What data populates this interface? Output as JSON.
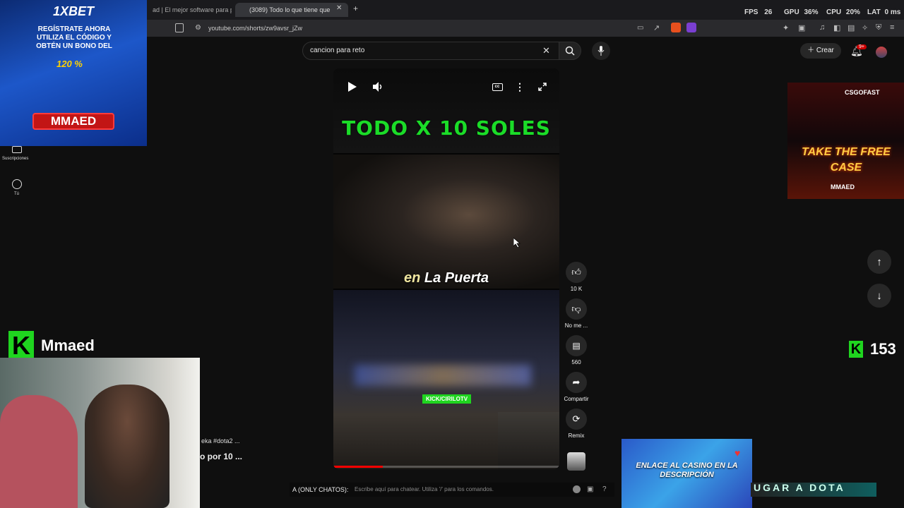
{
  "browser": {
    "tabs": [
      {
        "label": "ad | El mejor software para pote"
      },
      {
        "label": "(3089) Todo lo que tiene que"
      }
    ],
    "url": "youtube.com/shorts/zw9avsr_jZw"
  },
  "perf": {
    "fps_label": "FPS",
    "fps_value": "26",
    "gpu_label": "GPU",
    "gpu_value": "36%",
    "cpu_label": "CPU",
    "cpu_value": "20%",
    "lat_label": "LAT",
    "lat_value": "0 ms"
  },
  "youtube": {
    "search_value": "cancion para reto",
    "create_label": "Crear",
    "notif_badge": "9+",
    "sidebar": {
      "subscriptions": "Suscripciones",
      "you": "Tú"
    }
  },
  "video": {
    "title_overlay": "TODO X 10 SOLES",
    "caption_em": "en",
    "caption_rest": "La Puerta",
    "kick_label": "KICK/CIRILOTV",
    "progress": 0.22
  },
  "actions": {
    "likes": "10 K",
    "dislike": "No me ...",
    "comments": "560",
    "share": "Compartir",
    "remix": "Remix"
  },
  "stream_overlay": {
    "ad_brand": "1XBET",
    "ad_copy": "REGÍSTRATE AHORA UTILIZA EL CÓDIGO Y OBTÉN UN BONO DEL",
    "ad_percent": "120 %",
    "ad_code": "MMAED",
    "csgo_brand": "CSGOFAST",
    "csgo_cta": "TAKE THE FREE CASE",
    "csgo_tag": "MMAED",
    "streamer_name": "Mmaed",
    "kick_k": "K",
    "viewer_count": "153",
    "side_text_1": "eka #dota2 ...",
    "side_text_2": "o por 10 ...",
    "chat_prefix": "A (ONLY CHATOS):",
    "chat_placeholder": "Escribe aquí para chatear. Utiliza '/' para los comandos.",
    "casino_text": "ENLACE AL CASINO EN LA DESCRIPCIÓN",
    "dota_text": "UGAR A DOTA"
  },
  "colors": {
    "kick_green": "#1fd51f",
    "title_green": "#1bdc28",
    "youtube_red": "#ff0000"
  }
}
